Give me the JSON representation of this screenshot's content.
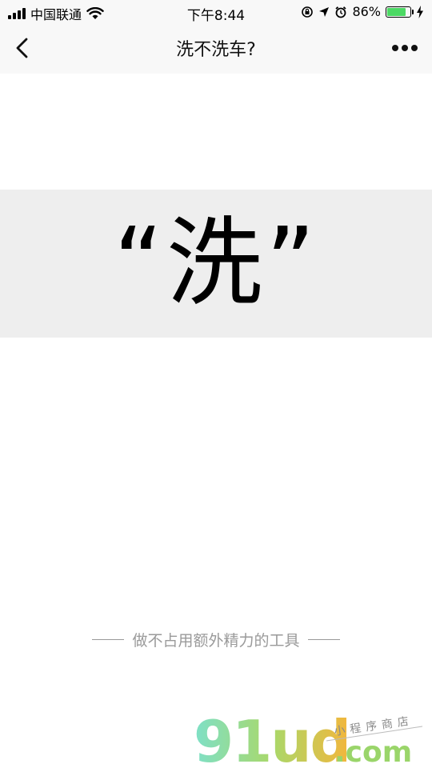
{
  "status_bar": {
    "carrier": "中国联通",
    "time": "下午8:44",
    "battery_percent_text": "86%",
    "battery_level": 0.86,
    "battery_color": "#4cd964"
  },
  "nav": {
    "title": "洗不洗车?",
    "back_icon": "chevron-left-icon",
    "more_icon": "ellipsis-icon"
  },
  "result": {
    "text": "“洗”"
  },
  "slogan": {
    "text": "做不占用额外精力的工具"
  },
  "watermark": {
    "logo_text": "91ud.com",
    "tagline": "小程序商店"
  }
}
